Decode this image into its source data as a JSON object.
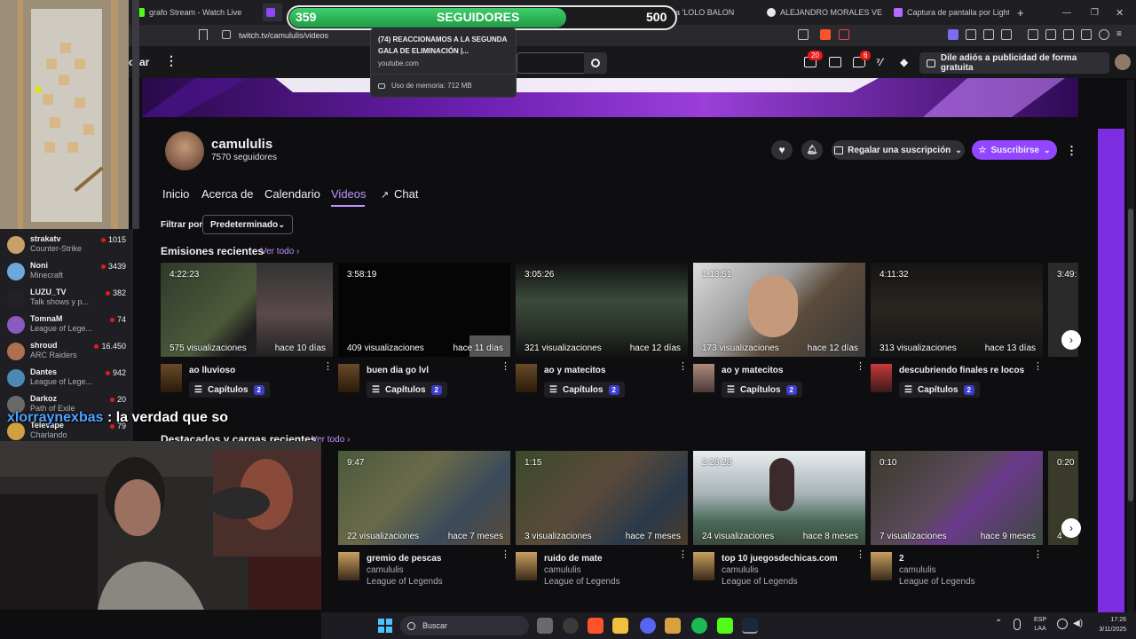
{
  "browser": {
    "tabs": [
      {
        "label": "grafo Stream - Watch Live",
        "color": "#53fc18"
      },
      {
        "label": "",
        "color": "#9147ff"
      },
      {
        "label": "Encuentra 'LOLO BALON",
        "color": "#ff4444"
      },
      {
        "label": "ALEJANDRO MORALES VERAC",
        "color": "#e8e8e8"
      },
      {
        "label": "Captura de pantalla por Lights",
        "color": "#b36bff"
      }
    ],
    "new_tab": "+",
    "url": "twitch.tv/camululis/videos"
  },
  "followers_goal": {
    "current": "359",
    "label": "SEGUIDORES",
    "target": "500",
    "progress": 0.718
  },
  "tooltip": {
    "title": "(74) REACCIONAMOS A LA SEGUNDA GALA DE ELIMINACIÓN |...",
    "domain": "youtube.com",
    "memory": "Uso de memoria: 712 MB"
  },
  "topnav": {
    "partial_label": "orar",
    "notif_count": "20",
    "whisper_count": "6",
    "ad_text": "Dile adiós a publicidad de forma gratuita"
  },
  "channel": {
    "name": "camululis",
    "followers": "7570 seguidores",
    "gift_label": "Regalar una suscripción",
    "subscribe_label": "Suscribirse",
    "tabs": [
      "Inicio",
      "Acerca de",
      "Calendario",
      "Videos",
      "Chat"
    ],
    "filter_label": "Filtrar por",
    "filter_value": "Predeterminado"
  },
  "recent": {
    "title": "Emisiones recientes",
    "see_all": "Ver todo",
    "items": [
      {
        "duration": "4:22:23",
        "views": "575 visualizaciones",
        "ago": "hace 10 días",
        "title": "ao lluvioso",
        "chapters": "Capítulos",
        "count": "2"
      },
      {
        "duration": "3:58:19",
        "views": "409 visualizaciones",
        "ago": "hace 11 días",
        "title": "buen dia go lvl",
        "chapters": "Capítulos",
        "count": "2"
      },
      {
        "duration": "3:05:26",
        "views": "321 visualizaciones",
        "ago": "hace 12 días",
        "title": "ao y matecitos",
        "chapters": "Capítulos",
        "count": "2"
      },
      {
        "duration": "1:13:51",
        "views": "173 visualizaciones",
        "ago": "hace 12 días",
        "title": "ao y matecitos",
        "chapters": "Capítulos",
        "count": "2"
      },
      {
        "duration": "4:11:32",
        "views": "313 visualizaciones",
        "ago": "hace 13 días",
        "title": "descubriendo finales re locos",
        "chapters": "Capítulos",
        "count": "2"
      }
    ],
    "partial_duration": "3:49:"
  },
  "uploads": {
    "title": "Destacados y cargas recientes",
    "see_all": "Ver todo",
    "items": [
      {
        "duration": "9:47",
        "views": "22 visualizaciones",
        "ago": "hace 7 meses",
        "title": "gremio de pescas",
        "channel": "camululis",
        "game": "League of Legends"
      },
      {
        "duration": "1:15",
        "views": "3 visualizaciones",
        "ago": "hace 7 meses",
        "title": "ruido de mate",
        "channel": "camululis",
        "game": "League of Legends"
      },
      {
        "duration": "2:28:28",
        "views": "24 visualizaciones",
        "ago": "hace 8 meses",
        "title": "top 10 juegosdechicas.com",
        "channel": "camululis",
        "game": "League of Legends"
      },
      {
        "duration": "0:10",
        "views": "7 visualizaciones",
        "ago": "hace 9 meses",
        "title": "2",
        "channel": "camululis",
        "game": "League of Legends"
      }
    ],
    "partial_duration": "0:20",
    "partial_views": "4"
  },
  "recommended": [
    {
      "name": "strakatv",
      "game": "Counter-Strike",
      "viewers": "1015",
      "color": "#c9a06a"
    },
    {
      "name": "Noni",
      "game": "Minecraft",
      "viewers": "3439",
      "color": "#6aa9d9"
    },
    {
      "name": "LUZU_TV",
      "game": "Talk shows y p...",
      "viewers": "382",
      "color": "#222222"
    },
    {
      "name": "TomnaM",
      "game": "League of Lege...",
      "viewers": "74",
      "color": "#8a5ac0"
    },
    {
      "name": "shroud",
      "game": "ARC Raiders",
      "viewers": "16.450",
      "color": "#b07050"
    },
    {
      "name": "Dantes",
      "game": "League of Lege...",
      "viewers": "942",
      "color": "#4a8ab0"
    },
    {
      "name": "Darkoz",
      "game": "Path of Exile",
      "viewers": "20",
      "color": "#6a6a6a"
    },
    {
      "name": "Televape",
      "game": "Charlando",
      "viewers": "79",
      "color": "#d0a040"
    }
  ],
  "chat": {
    "user": "xlorraynexbas",
    "sep": " : ",
    "text": "la verdad que so"
  },
  "taskbar": {
    "search": "Buscar",
    "lang": "ESP",
    "layout": "LAA",
    "time": "17:26",
    "date": "3/11/2025"
  }
}
